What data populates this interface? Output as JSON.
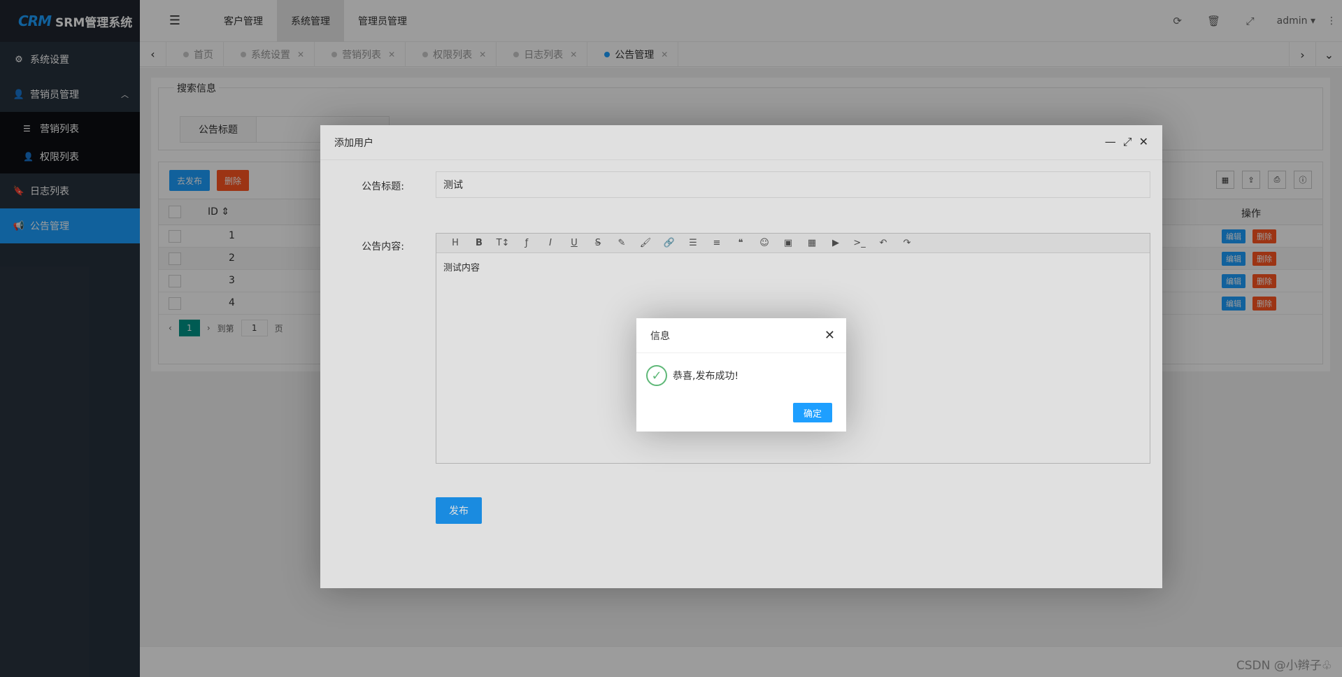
{
  "app": {
    "logo_mark": "CRM",
    "title": "SRM管理系统"
  },
  "sidebar": {
    "items": [
      {
        "label": "系统设置",
        "icon": "gears-icon"
      },
      {
        "label": "营销员管理",
        "icon": "user-icon",
        "expanded": true,
        "children": [
          {
            "label": "营销列表",
            "icon": "sliders-icon"
          },
          {
            "label": "权限列表",
            "icon": "user-times-icon"
          }
        ]
      },
      {
        "label": "日志列表",
        "icon": "bookmark-icon"
      },
      {
        "label": "公告管理",
        "icon": "bullhorn-icon",
        "active": true
      }
    ]
  },
  "header": {
    "nav": [
      "客户管理",
      "系统管理",
      "管理员管理"
    ],
    "active_nav": "系统管理",
    "user": "admin"
  },
  "tabs": [
    {
      "label": "首页",
      "closable": false
    },
    {
      "label": "系统设置",
      "closable": true
    },
    {
      "label": "营销列表",
      "closable": true
    },
    {
      "label": "权限列表",
      "closable": true
    },
    {
      "label": "日志列表",
      "closable": true
    },
    {
      "label": "公告管理",
      "closable": true,
      "active": true
    }
  ],
  "search": {
    "legend": "搜索信息",
    "title_label": "公告标题"
  },
  "table": {
    "btn_publish": "去发布",
    "btn_delete": "删除",
    "col_id": "ID",
    "col_op": "操作",
    "rows": [
      {
        "id": "1",
        "edit": "编辑",
        "del": "删除"
      },
      {
        "id": "2",
        "edit": "编辑",
        "del": "删除"
      },
      {
        "id": "3",
        "edit": "编辑",
        "del": "删除"
      },
      {
        "id": "4",
        "edit": "编辑",
        "del": "删除"
      }
    ],
    "pager": {
      "current": "1",
      "goto_label": "到第",
      "goto_value": "1",
      "page_unit": "页"
    }
  },
  "modal": {
    "title": "添加用户",
    "title_label": "公告标题:",
    "title_value": "测试",
    "content_label": "公告内容:",
    "content_value": "测试内容",
    "publish": "发布"
  },
  "dialog": {
    "title": "信息",
    "message": "恭喜,发布成功!",
    "ok": "确定"
  },
  "watermark": "CSDN @小辫子♧",
  "colors": {
    "accent": "#1e9fff",
    "danger": "#ff5722",
    "sidebar": "#28333e",
    "pager": "#009688"
  }
}
